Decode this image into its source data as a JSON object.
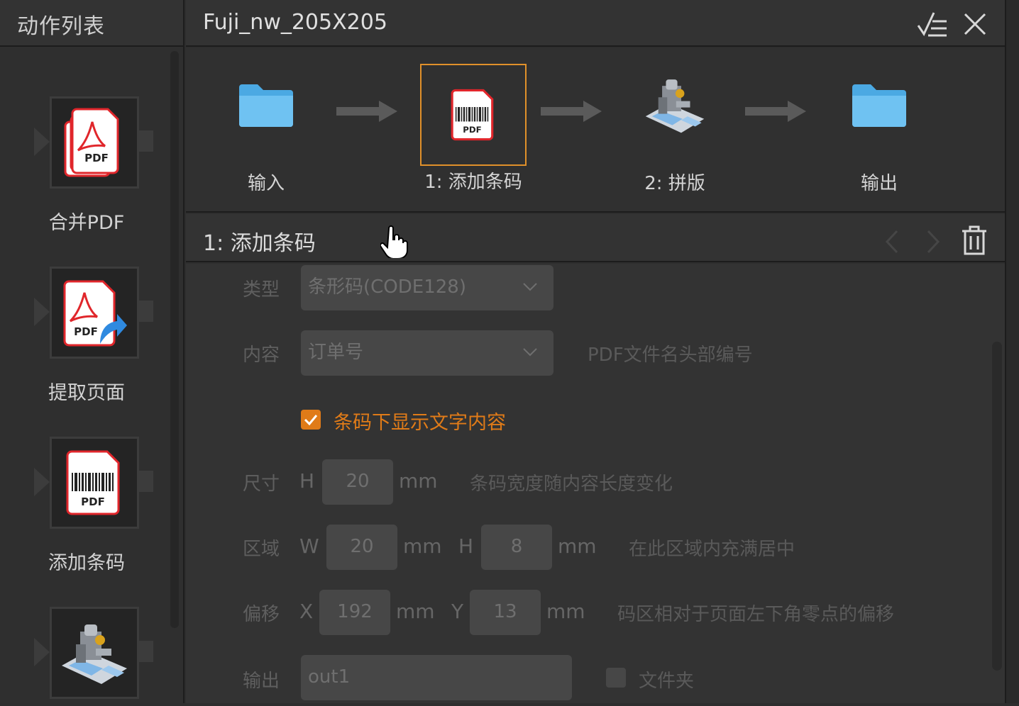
{
  "left_panel": {
    "title": "动作列表",
    "tools": [
      {
        "label": "合并PDF",
        "icon": "merge-pdf-icon"
      },
      {
        "label": "提取页面",
        "icon": "extract-pages-icon"
      },
      {
        "label": "添加条码",
        "icon": "add-barcode-icon"
      },
      {
        "label": "",
        "icon": "imposition-machine-icon"
      }
    ]
  },
  "header": {
    "title": "Fuji_nw_205X205"
  },
  "pipeline": {
    "stages": [
      {
        "label": "输入",
        "icon": "folder-icon"
      },
      {
        "label": "1: 添加条码",
        "icon": "add-barcode-icon"
      },
      {
        "label": "2: 拼版",
        "icon": "imposition-machine-icon"
      },
      {
        "label": "输出",
        "icon": "folder-icon"
      }
    ]
  },
  "step": {
    "title": "1: 添加条码"
  },
  "form": {
    "type_label": "类型",
    "type_value": "条形码(CODE128)",
    "content_label": "内容",
    "content_value": "订单号",
    "content_hint": "PDF文件名头部编号",
    "show_text_label": "条码下显示文字内容",
    "size_label": "尺寸",
    "size_h_label": "H",
    "size_h_value": "20",
    "size_unit": "mm",
    "size_hint": "条码宽度随内容长度变化",
    "area_label": "区域",
    "area_w_label": "W",
    "area_w_value": "20",
    "area_w_unit": "mm",
    "area_h_label": "H",
    "area_h_value": "8",
    "area_h_unit": "mm",
    "area_hint": "在此区域内充满居中",
    "offset_label": "偏移",
    "offset_x_label": "X",
    "offset_x_value": "192",
    "offset_x_unit": "mm",
    "offset_y_label": "Y",
    "offset_y_value": "13",
    "offset_y_unit": "mm",
    "offset_hint": "码区相对于页面左下角零点的偏移",
    "output_label": "输出",
    "output_value": "out1",
    "folder_label": "文件夹"
  },
  "colors": {
    "accent": "#e07b18",
    "selection_border": "#e0902a",
    "background": "#2e2e2e"
  }
}
